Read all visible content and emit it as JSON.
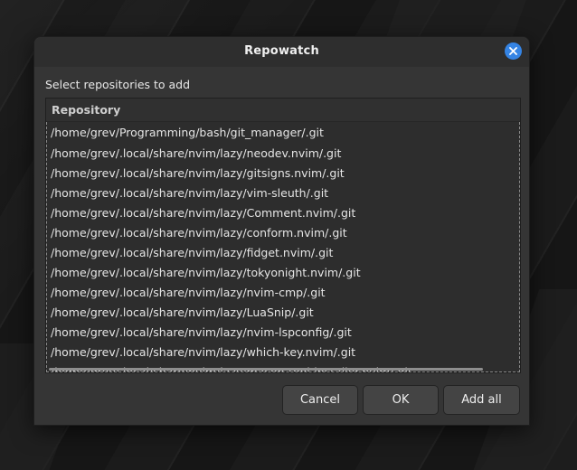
{
  "dialog": {
    "title": "Repowatch",
    "prompt": "Select repositories to add",
    "close_icon": "close-icon",
    "accent_color": "#3584e4"
  },
  "list": {
    "column_header": "Repository",
    "rows": [
      "/home/grev/Programming/bash/git_manager/.git",
      "/home/grev/.local/share/nvim/lazy/neodev.nvim/.git",
      "/home/grev/.local/share/nvim/lazy/gitsigns.nvim/.git",
      "/home/grev/.local/share/nvim/lazy/vim-sleuth/.git",
      "/home/grev/.local/share/nvim/lazy/Comment.nvim/.git",
      "/home/grev/.local/share/nvim/lazy/conform.nvim/.git",
      "/home/grev/.local/share/nvim/lazy/fidget.nvim/.git",
      "/home/grev/.local/share/nvim/lazy/tokyonight.nvim/.git",
      "/home/grev/.local/share/nvim/lazy/nvim-cmp/.git",
      "/home/grev/.local/share/nvim/lazy/LuaSnip/.git",
      "/home/grev/.local/share/nvim/lazy/nvim-lspconfig/.git",
      "/home/grev/.local/share/nvim/lazy/which-key.nvim/.git",
      "/home/grev/.local/share/nvim/lazy/mason-tool-installer.nvim/.git"
    ]
  },
  "buttons": {
    "cancel": "Cancel",
    "ok": "OK",
    "add_all": "Add all"
  }
}
